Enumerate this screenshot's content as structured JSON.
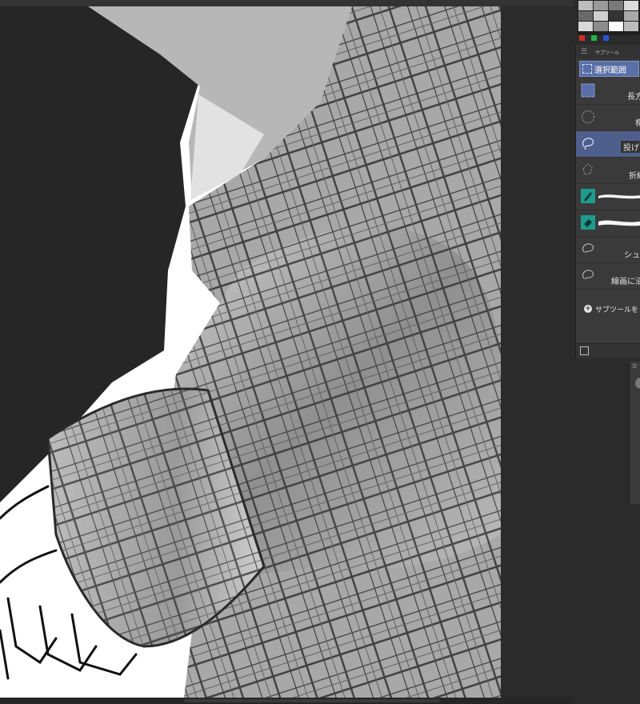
{
  "subtool_panel": {
    "title": "サブツール",
    "group_tab": "選択範囲",
    "tools": [
      {
        "label": "長方",
        "icon": "rect-select-icon"
      },
      {
        "label": "楕",
        "icon": "ellipse-select-icon"
      },
      {
        "label": "投げ",
        "icon": "lasso-select-icon"
      },
      {
        "label": "折線",
        "icon": "polyline-select-icon"
      },
      {
        "label": "",
        "icon": "selection-pen-icon"
      },
      {
        "label": "",
        "icon": "selection-eraser-icon"
      },
      {
        "label": "シュリ",
        "icon": "shrink-select-icon"
      },
      {
        "label": "線画に沿",
        "icon": "line-follow-select-icon"
      }
    ],
    "add_subtool": "サブツールを"
  },
  "colors": {
    "accent": "#5a6fa6",
    "selected_row": "#4f5f8c",
    "tool_teal": "#1e9b8e",
    "dot_red": "#d22b2b",
    "dot_green": "#22b34a",
    "dot_blue": "#2a55d6"
  }
}
